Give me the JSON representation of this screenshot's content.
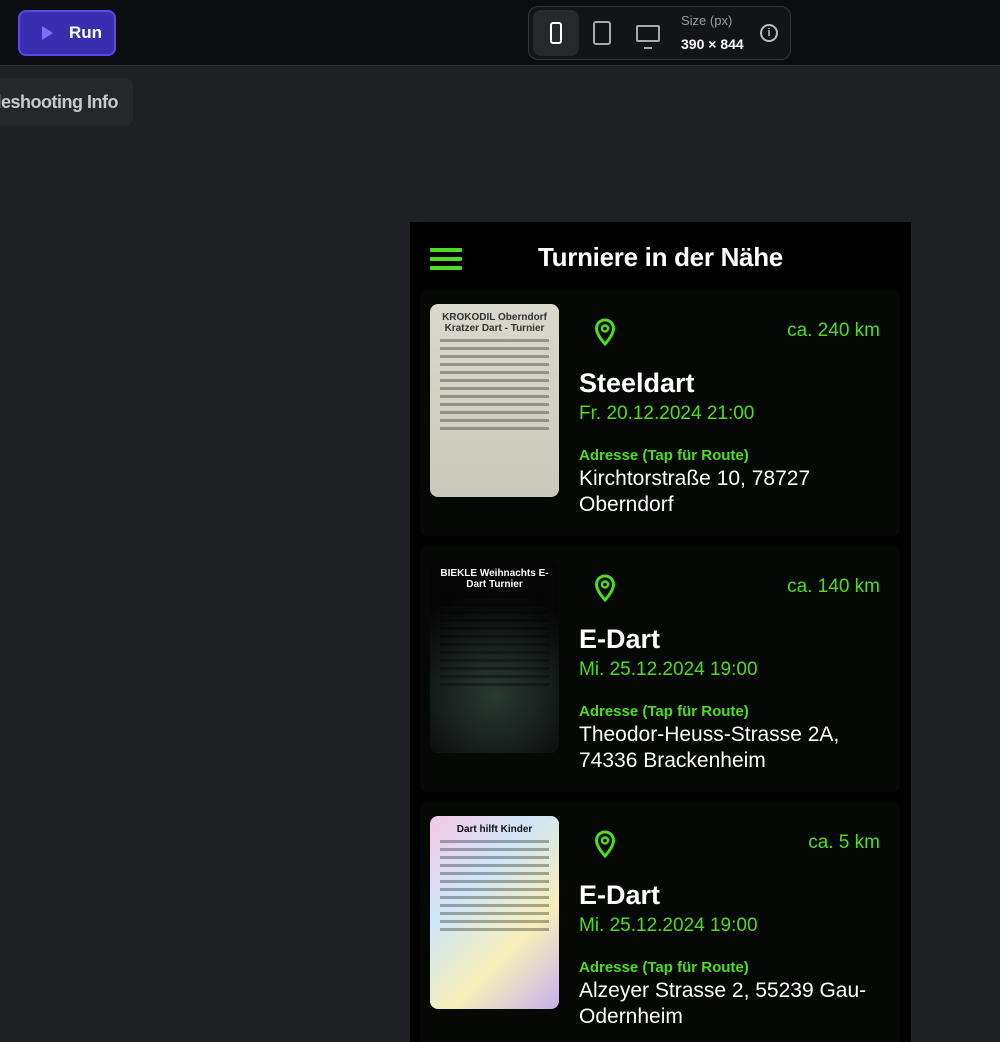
{
  "toolbar": {
    "run_label": "Run",
    "size_label": "Size (px)",
    "size_value": "390 × 844",
    "info_icon": "i",
    "devices": [
      "phone",
      "tablet",
      "desktop"
    ],
    "active_device": "phone",
    "accent": "#3a2eb0"
  },
  "chip": {
    "label": "leshooting Info"
  },
  "app": {
    "title": "Turniere in der Nähe",
    "accent": "#4fdc1e",
    "address_label": "Adresse (Tap für Route)",
    "tournaments": [
      {
        "type": "Steeldart",
        "date": "Fr. 20.12.2024 21:00",
        "distance": "ca. 240 km",
        "address": "Kirchtorstraße 10, 78727 Oberndorf",
        "poster_text": "KROKODIL Oberndorf Kratzer Dart - Turnier"
      },
      {
        "type": "E-Dart",
        "date": "Mi. 25.12.2024 19:00",
        "distance": "ca. 140 km",
        "address": "Theodor-Heuss-Strasse 2A, 74336 Brackenheim",
        "poster_text": "BIEKLE Weihnachts E- Dart Turnier"
      },
      {
        "type": "E-Dart",
        "date": "Mi. 25.12.2024 19:00",
        "distance": "ca. 5 km",
        "address": "Alzeyer Strasse 2, 55239 Gau-Odernheim",
        "poster_text": "Dart hilft Kinder"
      }
    ]
  }
}
